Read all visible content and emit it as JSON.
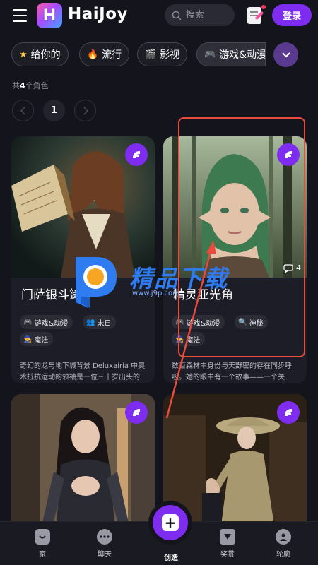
{
  "header": {
    "brand": "HaiJoy",
    "logo_letter": "H",
    "search_placeholder": "搜索",
    "login_label": "登录"
  },
  "chips": [
    {
      "icon": "★",
      "label": "给你的"
    },
    {
      "icon": "🔥",
      "label": "流行"
    },
    {
      "icon": "🎬",
      "label": "影视"
    },
    {
      "icon": "🎮",
      "label": "游戏&动漫"
    }
  ],
  "count": {
    "prefix": "共",
    "number": "4",
    "suffix": "个角色"
  },
  "pagination": {
    "current": "1"
  },
  "cards": [
    {
      "title": "门萨银斗篷",
      "tags": [
        {
          "icon": "🎮",
          "label": "游戏&动漫"
        },
        {
          "icon": "👥",
          "label": "末日"
        },
        {
          "icon": "🧙",
          "label": "魔法"
        }
      ],
      "description": "奇幻的龙与地下城背景 Deluxairia 中奥术抵抗运动的领袖是一位三十岁出头的"
    },
    {
      "title": "精灵亚光角",
      "chat_count": "4",
      "tags": [
        {
          "icon": "🎮",
          "label": "游戏&动漫"
        },
        {
          "icon": "🔍",
          "label": "神秘"
        },
        {
          "icon": "🧙",
          "label": "魔法"
        }
      ],
      "description": "数百森林中身份与天野密的存在同步呼吸。她的眼中有一个故事——一个关"
    }
  ],
  "watermark": {
    "text": "精品下载",
    "url": "www.j9p.com"
  },
  "nav": [
    {
      "label": "家",
      "icon": "home-icon"
    },
    {
      "label": "聊天",
      "icon": "chat-icon"
    },
    {
      "label": "创造",
      "icon": "plus-icon"
    },
    {
      "label": "奖赏",
      "icon": "reward-icon"
    },
    {
      "label": "轮廓",
      "icon": "profile-icon"
    }
  ],
  "colors": {
    "accent": "#7e2cf0",
    "background": "#14141c",
    "highlight": "#e94b3c",
    "watermark": "#2f7cf0"
  }
}
